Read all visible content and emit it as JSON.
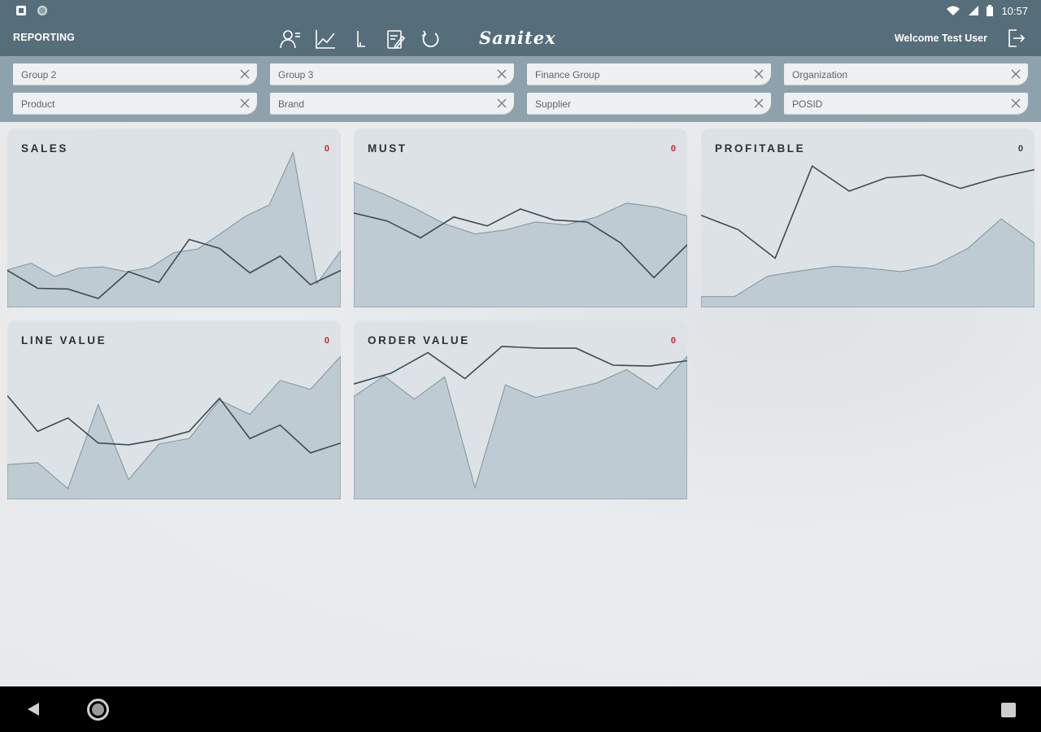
{
  "status_bar": {
    "time": "10:57"
  },
  "app_bar": {
    "title": "REPORTING",
    "brand": "Sanitex",
    "welcome": "Welcome Test User",
    "icons": [
      "users-icon",
      "line-chart-icon",
      "axis-chart-icon",
      "edit-document-icon",
      "refresh-icon"
    ]
  },
  "filters": [
    {
      "label": "Group 2"
    },
    {
      "label": "Group 3"
    },
    {
      "label": "Finance Group"
    },
    {
      "label": "Organization"
    },
    {
      "label": "Product"
    },
    {
      "label": "Brand"
    },
    {
      "label": "Supplier"
    },
    {
      "label": "POSID"
    }
  ],
  "colors": {
    "bar": "#566e7a",
    "filter_bar": "#8ea2ad",
    "area_fill": "#b9c7cf",
    "line": "#3c4a54",
    "value_red": "#c0262d"
  },
  "chart_data": [
    {
      "type": "area",
      "title": "SALES",
      "value": "0",
      "area_series": [
        0.63,
        0.74,
        0.52,
        0.66,
        0.68,
        0.6,
        0.67,
        0.92,
        0.98,
        1.25,
        1.53,
        1.72,
        2.6,
        0.4,
        0.95
      ],
      "line_series": [
        0.62,
        0.32,
        0.31,
        0.15,
        0.6,
        0.42,
        1.14,
        0.99,
        0.58,
        0.86,
        0.38,
        0.62
      ],
      "ylim": [
        0,
        3
      ]
    },
    {
      "type": "area",
      "title": "MUST",
      "value": "0",
      "area_series": [
        1.26,
        1.14,
        1.0,
        0.84,
        0.74,
        0.78,
        0.86,
        0.83,
        0.91,
        1.05,
        1.01,
        0.92
      ],
      "line_series": [
        0.95,
        0.87,
        0.7,
        0.91,
        0.82,
        0.99,
        0.88,
        0.86,
        0.65,
        0.3,
        0.63
      ],
      "ylim": [
        0,
        1.8
      ]
    },
    {
      "type": "area",
      "title": "PROFITABLE",
      "value": "0",
      "area_series": [
        0.12,
        0.12,
        0.35,
        0.41,
        0.46,
        0.44,
        0.4,
        0.47,
        0.66,
        0.99,
        0.72
      ],
      "line_series": [
        1.03,
        0.87,
        0.55,
        1.58,
        1.3,
        1.45,
        1.48,
        1.33,
        1.45,
        1.54
      ],
      "ylim": [
        0,
        2
      ]
    },
    {
      "type": "area",
      "title": "LINE VALUE",
      "value": "0",
      "area_series": [
        0.39,
        0.41,
        0.12,
        1.06,
        0.22,
        0.62,
        0.68,
        1.11,
        0.95,
        1.33,
        1.23,
        1.6
      ],
      "line_series": [
        1.16,
        0.76,
        0.91,
        0.63,
        0.61,
        0.67,
        0.76,
        1.13,
        0.68,
        0.83,
        0.52,
        0.63
      ],
      "ylim": [
        0,
        2
      ]
    },
    {
      "type": "area",
      "title": "ORDER VALUE",
      "value": "0",
      "area_series": [
        1.15,
        1.38,
        1.12,
        1.37,
        0.13,
        1.28,
        1.14,
        1.22,
        1.3,
        1.45,
        1.23,
        1.6
      ],
      "line_series": [
        1.29,
        1.41,
        1.64,
        1.35,
        1.71,
        1.69,
        1.69,
        1.5,
        1.49,
        1.55
      ],
      "ylim": [
        0,
        2
      ]
    }
  ],
  "nav": {
    "back": "back-icon",
    "home": "home-icon",
    "recent": "recent-apps-icon"
  }
}
